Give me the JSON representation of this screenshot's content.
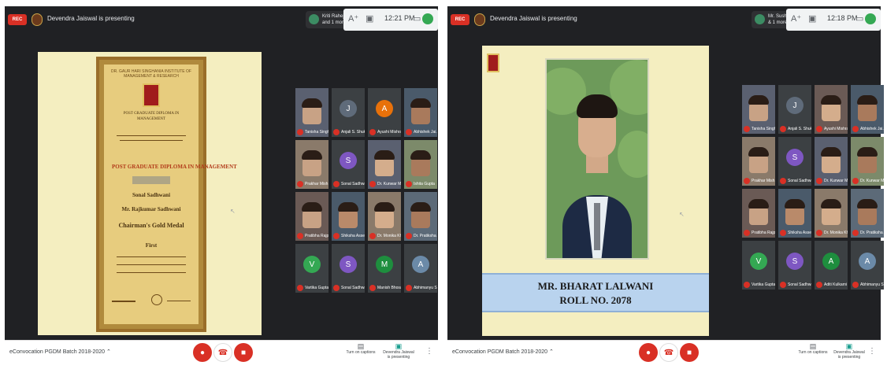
{
  "left": {
    "record_label": "REC",
    "presenting_text": "Devendra Jaiswal is presenting",
    "host_name": "Kriti Raheja",
    "host_sub": "and 1 more",
    "time": "12:21 PM",
    "meeting_name": "eConvocation PGDM Batch 2018-2020",
    "certificate": {
      "header_arc": "DR. GAUR HARI SINGHANIA INSTITUTE OF MANAGEMENT & RESEARCH",
      "line_title1": "POST GRADUATE DIPLOMA IN",
      "line_title2": "MANAGEMENT",
      "program": "POST GRADUATE DIPLOMA IN MANAGEMENT",
      "recipient": "Sonal Sadhwani",
      "father_line": "Mr. Rajkumar Sadhwani",
      "award": "Chairman's Gold Medal",
      "grade": "First"
    },
    "tiles": [
      {
        "name": "Tanisha Singhal",
        "type": "photo"
      },
      {
        "name": "Anjali S. Shukla",
        "type": "initial",
        "initial": "J",
        "color": "#5f6b7a"
      },
      {
        "name": "Ayushi Mishra",
        "type": "initial",
        "initial": "A",
        "color": "#e8710a"
      },
      {
        "name": "Abhishek Jai...",
        "type": "photo"
      },
      {
        "name": "Prakhar Mish...",
        "type": "photo"
      },
      {
        "name": "Sonal Sadhwa...",
        "type": "initial",
        "initial": "S",
        "color": "#7e57c2"
      },
      {
        "name": "Dr. Kunwar M...",
        "type": "photo"
      },
      {
        "name": "Ishita Gupta",
        "type": "photo"
      },
      {
        "name": "Pratibha Rajput",
        "type": "photo"
      },
      {
        "name": "Shiksha Assem...",
        "type": "photo"
      },
      {
        "name": "Dr. Monika Kh...",
        "type": "photo"
      },
      {
        "name": "Dr. Pratiksha A...",
        "type": "photo"
      },
      {
        "name": "Vartika Gupta",
        "type": "initial",
        "initial": "V",
        "color": "#34a853"
      },
      {
        "name": "Sonal Sadhwa...",
        "type": "initial",
        "initial": "S",
        "color": "#7e57c2"
      },
      {
        "name": "Manish Bhosa...",
        "type": "initial",
        "initial": "M",
        "color": "#1e8e3e"
      },
      {
        "name": "Abhimanyu Si...",
        "type": "initial",
        "initial": "A",
        "color": "#6b8aa8"
      }
    ],
    "bottom": {
      "captions_label": "Turn on captions",
      "present_label": "Devendra Jaiswal is presenting"
    }
  },
  "right": {
    "record_label": "REC",
    "presenting_text": "Devendra Jaiswal is presenting",
    "host_name": "Mr. Sushil Rajpal",
    "host_sub": "& 1 more",
    "time": "12:18 PM",
    "meeting_name": "eConvocation PGDM Batch 2018-2020",
    "slide_name": "MR. BHARAT LALWANI",
    "slide_roll": "ROLL NO. 2078",
    "tiles": [
      {
        "name": "Tanisha Singhal",
        "type": "photo"
      },
      {
        "name": "Anjali S. Shukla",
        "type": "initial",
        "initial": "J",
        "color": "#5f6b7a"
      },
      {
        "name": "Ayushi Mishra",
        "type": "photo"
      },
      {
        "name": "Abhishek Jai...",
        "type": "photo"
      },
      {
        "name": "Prakhar Mish...",
        "type": "photo"
      },
      {
        "name": "Sonal Sadhwa...",
        "type": "initial",
        "initial": "S",
        "color": "#7e57c2"
      },
      {
        "name": "Dr. Kunwar M...",
        "type": "photo"
      },
      {
        "name": "Dr. Kunwar Mi...",
        "type": "photo"
      },
      {
        "name": "Pratibha Rajput",
        "type": "photo"
      },
      {
        "name": "Shiksha Assem...",
        "type": "photo"
      },
      {
        "name": "Dr. Monika Kh...",
        "type": "photo"
      },
      {
        "name": "Dr. Pratiksha A...",
        "type": "photo"
      },
      {
        "name": "Vartika Gupta",
        "type": "initial",
        "initial": "V",
        "color": "#34a853"
      },
      {
        "name": "Sonal Sadhwa...",
        "type": "initial",
        "initial": "S",
        "color": "#7e57c2"
      },
      {
        "name": "Aditi Kulkarni",
        "type": "initial",
        "initial": "A",
        "color": "#1e8e3e"
      },
      {
        "name": "Abhimanyu Si...",
        "type": "initial",
        "initial": "A",
        "color": "#6b8aa8"
      }
    ],
    "bottom": {
      "captions_label": "Turn on captions",
      "present_label": "Devendra Jaiswal is presenting"
    }
  }
}
